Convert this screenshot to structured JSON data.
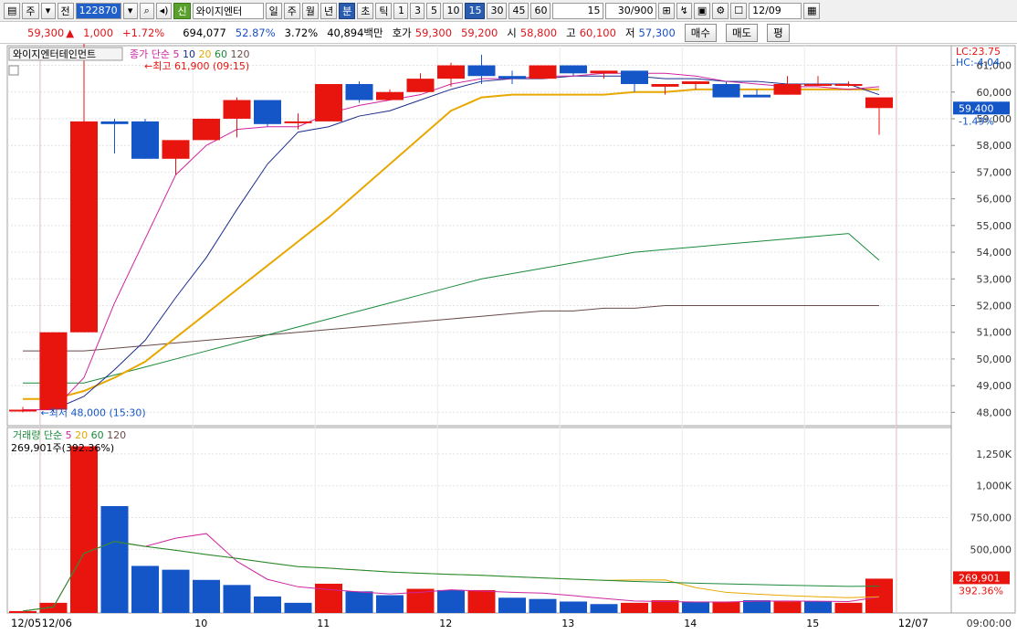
{
  "toolbar": {
    "buttons": [
      "주",
      "전"
    ],
    "code_value": "122870",
    "credit_badge": "신",
    "stock_name": "와이지엔터",
    "period_buttons": [
      "일",
      "주",
      "월",
      "년",
      "분",
      "초",
      "틱"
    ],
    "active_period": "분",
    "interval_buttons": [
      "1",
      "3",
      "5",
      "10",
      "15",
      "30",
      "45",
      "60"
    ],
    "active_interval": "15",
    "interval_select": "15",
    "count_value": "30/900",
    "date_value": "12/09"
  },
  "quote": {
    "price": "59,300",
    "change_arrow": "▲",
    "change": "1,000",
    "change_pct": "+1.72%",
    "volume": "694,077",
    "ratio": "52.87%",
    "turnover_pct": "3.72%",
    "amount": "40,894백만",
    "ask_label": "호가",
    "ask": "59,300",
    "bid": "59,200",
    "open_label": "시",
    "open": "58,800",
    "high_label": "고",
    "high": "60,100",
    "low_label": "저",
    "low": "57,300",
    "buy_label": "매수",
    "sell_label": "매도",
    "avg_label": "평"
  },
  "chart": {
    "title_tag": "와이지엔터테인먼트",
    "legend_prefix": "종가 단순",
    "ma_periods": [
      "5",
      "10",
      "20",
      "60",
      "120"
    ],
    "colors": {
      "ma5": "#d0259f",
      "ma10": "#1b2c8c",
      "ma20": "#e8a800",
      "ma60": "#1a8a3a",
      "ma120": "#6b4a4a",
      "up": "#e8150f",
      "down": "#1456c8"
    },
    "high_marker": "최고 61,900 (09:15)",
    "low_marker": "최저 48,000 (15:30)",
    "lc_label": "LC:23.75",
    "hc_label": "HC:-4.04",
    "current_price_tag": "59,400",
    "current_change_tag": "-1.49%",
    "price_ticks": [
      "61,000",
      "60,000",
      "59,000",
      "58,000",
      "57,000",
      "56,000",
      "55,000",
      "54,000",
      "53,000",
      "52,000",
      "51,000",
      "50,000",
      "49,000",
      "48,000"
    ],
    "vol_legend_prefix": "거래량 단순",
    "vol_ma_periods": [
      "5",
      "20",
      "60",
      "120"
    ],
    "vol_summary": "269,901주(392.36%)",
    "vol_ticks": [
      "1,250K",
      "1,000K",
      "750,000",
      "500,000"
    ],
    "vol_current_tag": "269,901",
    "vol_current_pct": "392.36%",
    "x_labels": [
      "12/05",
      "12/06",
      "10",
      "11",
      "12",
      "13",
      "14",
      "15",
      "12/07"
    ],
    "time_label": "09:00:00"
  },
  "chart_data": {
    "type": "candlestick",
    "price_range": [
      47500,
      61600
    ],
    "candles": [
      {
        "o": 48100,
        "h": 48200,
        "l": 48000,
        "c": 48100
      },
      {
        "o": 48100,
        "h": 51000,
        "l": 48000,
        "c": 51000
      },
      {
        "o": 51000,
        "h": 61900,
        "l": 51000,
        "c": 58900
      },
      {
        "o": 58900,
        "h": 59000,
        "l": 57700,
        "c": 58800
      },
      {
        "o": 58900,
        "h": 59000,
        "l": 57500,
        "c": 57500
      },
      {
        "o": 57500,
        "h": 58000,
        "l": 56900,
        "c": 58200
      },
      {
        "o": 58200,
        "h": 58900,
        "l": 58300,
        "c": 59000
      },
      {
        "o": 59000,
        "h": 59800,
        "l": 58300,
        "c": 59700
      },
      {
        "o": 59700,
        "h": 59700,
        "l": 58700,
        "c": 58800
      },
      {
        "o": 58900,
        "h": 59200,
        "l": 58600,
        "c": 58900
      },
      {
        "o": 58900,
        "h": 60300,
        "l": 58900,
        "c": 60300
      },
      {
        "o": 60300,
        "h": 60400,
        "l": 59600,
        "c": 59700
      },
      {
        "o": 59700,
        "h": 60100,
        "l": 59700,
        "c": 60000
      },
      {
        "o": 60000,
        "h": 60700,
        "l": 60000,
        "c": 60500
      },
      {
        "o": 60500,
        "h": 61100,
        "l": 60200,
        "c": 61000
      },
      {
        "o": 61000,
        "h": 61400,
        "l": 60300,
        "c": 60600
      },
      {
        "o": 60600,
        "h": 60800,
        "l": 60300,
        "c": 60500
      },
      {
        "o": 60500,
        "h": 61000,
        "l": 60500,
        "c": 61000
      },
      {
        "o": 61000,
        "h": 61000,
        "l": 60600,
        "c": 60700
      },
      {
        "o": 60700,
        "h": 60800,
        "l": 60500,
        "c": 60800
      },
      {
        "o": 60800,
        "h": 60800,
        "l": 60000,
        "c": 60300
      },
      {
        "o": 60200,
        "h": 60300,
        "l": 59900,
        "c": 60300
      },
      {
        "o": 60300,
        "h": 60400,
        "l": 60100,
        "c": 60400
      },
      {
        "o": 60300,
        "h": 60400,
        "l": 59800,
        "c": 59800
      },
      {
        "o": 59900,
        "h": 60100,
        "l": 59800,
        "c": 59800
      },
      {
        "o": 59900,
        "h": 60600,
        "l": 59900,
        "c": 60300
      },
      {
        "o": 60300,
        "h": 60600,
        "l": 60300,
        "c": 60300
      },
      {
        "o": 60300,
        "h": 60400,
        "l": 60200,
        "c": 60300
      },
      {
        "o": 59400,
        "h": 59400,
        "l": 58400,
        "c": 59800
      }
    ],
    "volume": [
      15000,
      80000,
      1310000,
      840000,
      370000,
      340000,
      260000,
      220000,
      130000,
      80000,
      230000,
      170000,
      140000,
      190000,
      180000,
      180000,
      120000,
      110000,
      90000,
      70000,
      80000,
      100000,
      90000,
      90000,
      100000,
      90000,
      90000,
      80000,
      269901
    ],
    "volume_up": [
      true,
      true,
      true,
      false,
      false,
      false,
      false,
      false,
      false,
      false,
      true,
      false,
      false,
      true,
      false,
      true,
      false,
      false,
      false,
      false,
      true,
      true,
      false,
      true,
      false,
      true,
      false,
      true,
      true
    ],
    "volume_range": [
      0,
      1400000
    ],
    "ma5": [
      48100,
      48100,
      49300,
      52100,
      54500,
      56900,
      58000,
      58600,
      58700,
      58700,
      59200,
      59500,
      59700,
      59900,
      60300,
      60500,
      60500,
      60600,
      60600,
      60700,
      60700,
      60700,
      60600,
      60400,
      60300,
      60200,
      60200,
      60100,
      60200
    ],
    "ma10": [
      48100,
      48100,
      48600,
      49600,
      50700,
      52300,
      53800,
      55600,
      57300,
      58500,
      58700,
      59100,
      59300,
      59700,
      60100,
      60400,
      60500,
      60500,
      60600,
      60600,
      60600,
      60500,
      60500,
      60400,
      60400,
      60300,
      60300,
      60300,
      59900
    ],
    "ma20": [
      48500,
      48500,
      48800,
      49300,
      49900,
      50800,
      51700,
      52600,
      53500,
      54400,
      55300,
      56300,
      57300,
      58300,
      59300,
      59800,
      59900,
      59900,
      59900,
      59900,
      60000,
      60000,
      60100,
      60100,
      60100,
      60100,
      60100,
      60100,
      60100
    ],
    "ma60": [
      49100,
      49100,
      49100,
      49400,
      49700,
      50000,
      50300,
      50600,
      50900,
      51200,
      51500,
      51800,
      52100,
      52400,
      52700,
      53000,
      53200,
      53400,
      53600,
      53800,
      54000,
      54100,
      54200,
      54300,
      54400,
      54500,
      54600,
      54700,
      53700
    ],
    "ma120": [
      50300,
      50300,
      50300,
      50400,
      50500,
      50600,
      50700,
      50800,
      50900,
      51000,
      51100,
      51200,
      51300,
      51400,
      51500,
      51600,
      51700,
      51800,
      51800,
      51900,
      51900,
      52000,
      52000,
      52000,
      52000,
      52000,
      52000,
      52000,
      52000
    ]
  }
}
